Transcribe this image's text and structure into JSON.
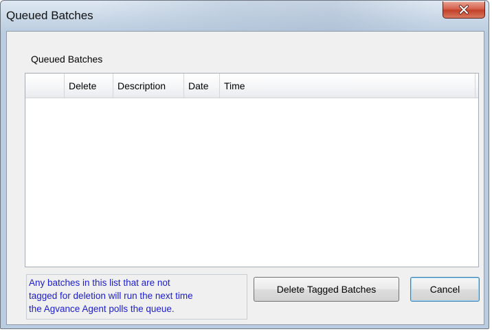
{
  "window": {
    "title": "Queued Batches"
  },
  "icons": {
    "close": "close-icon"
  },
  "group": {
    "label": "Queued Batches"
  },
  "grid": {
    "columns": [
      "",
      "Delete",
      "Description",
      "Date",
      "Time"
    ],
    "rows": []
  },
  "note": {
    "line1": "Any batches in this list that are not",
    "line2": "tagged for deletion will run the next time",
    "line3": "the Agvance Agent polls the queue."
  },
  "buttons": {
    "delete_tagged": "Delete Tagged Batches",
    "cancel": "Cancel"
  },
  "colors": {
    "note_text": "#1c1cd0",
    "close_button": "#c2412b",
    "default_button_border": "#3c7fb1"
  }
}
